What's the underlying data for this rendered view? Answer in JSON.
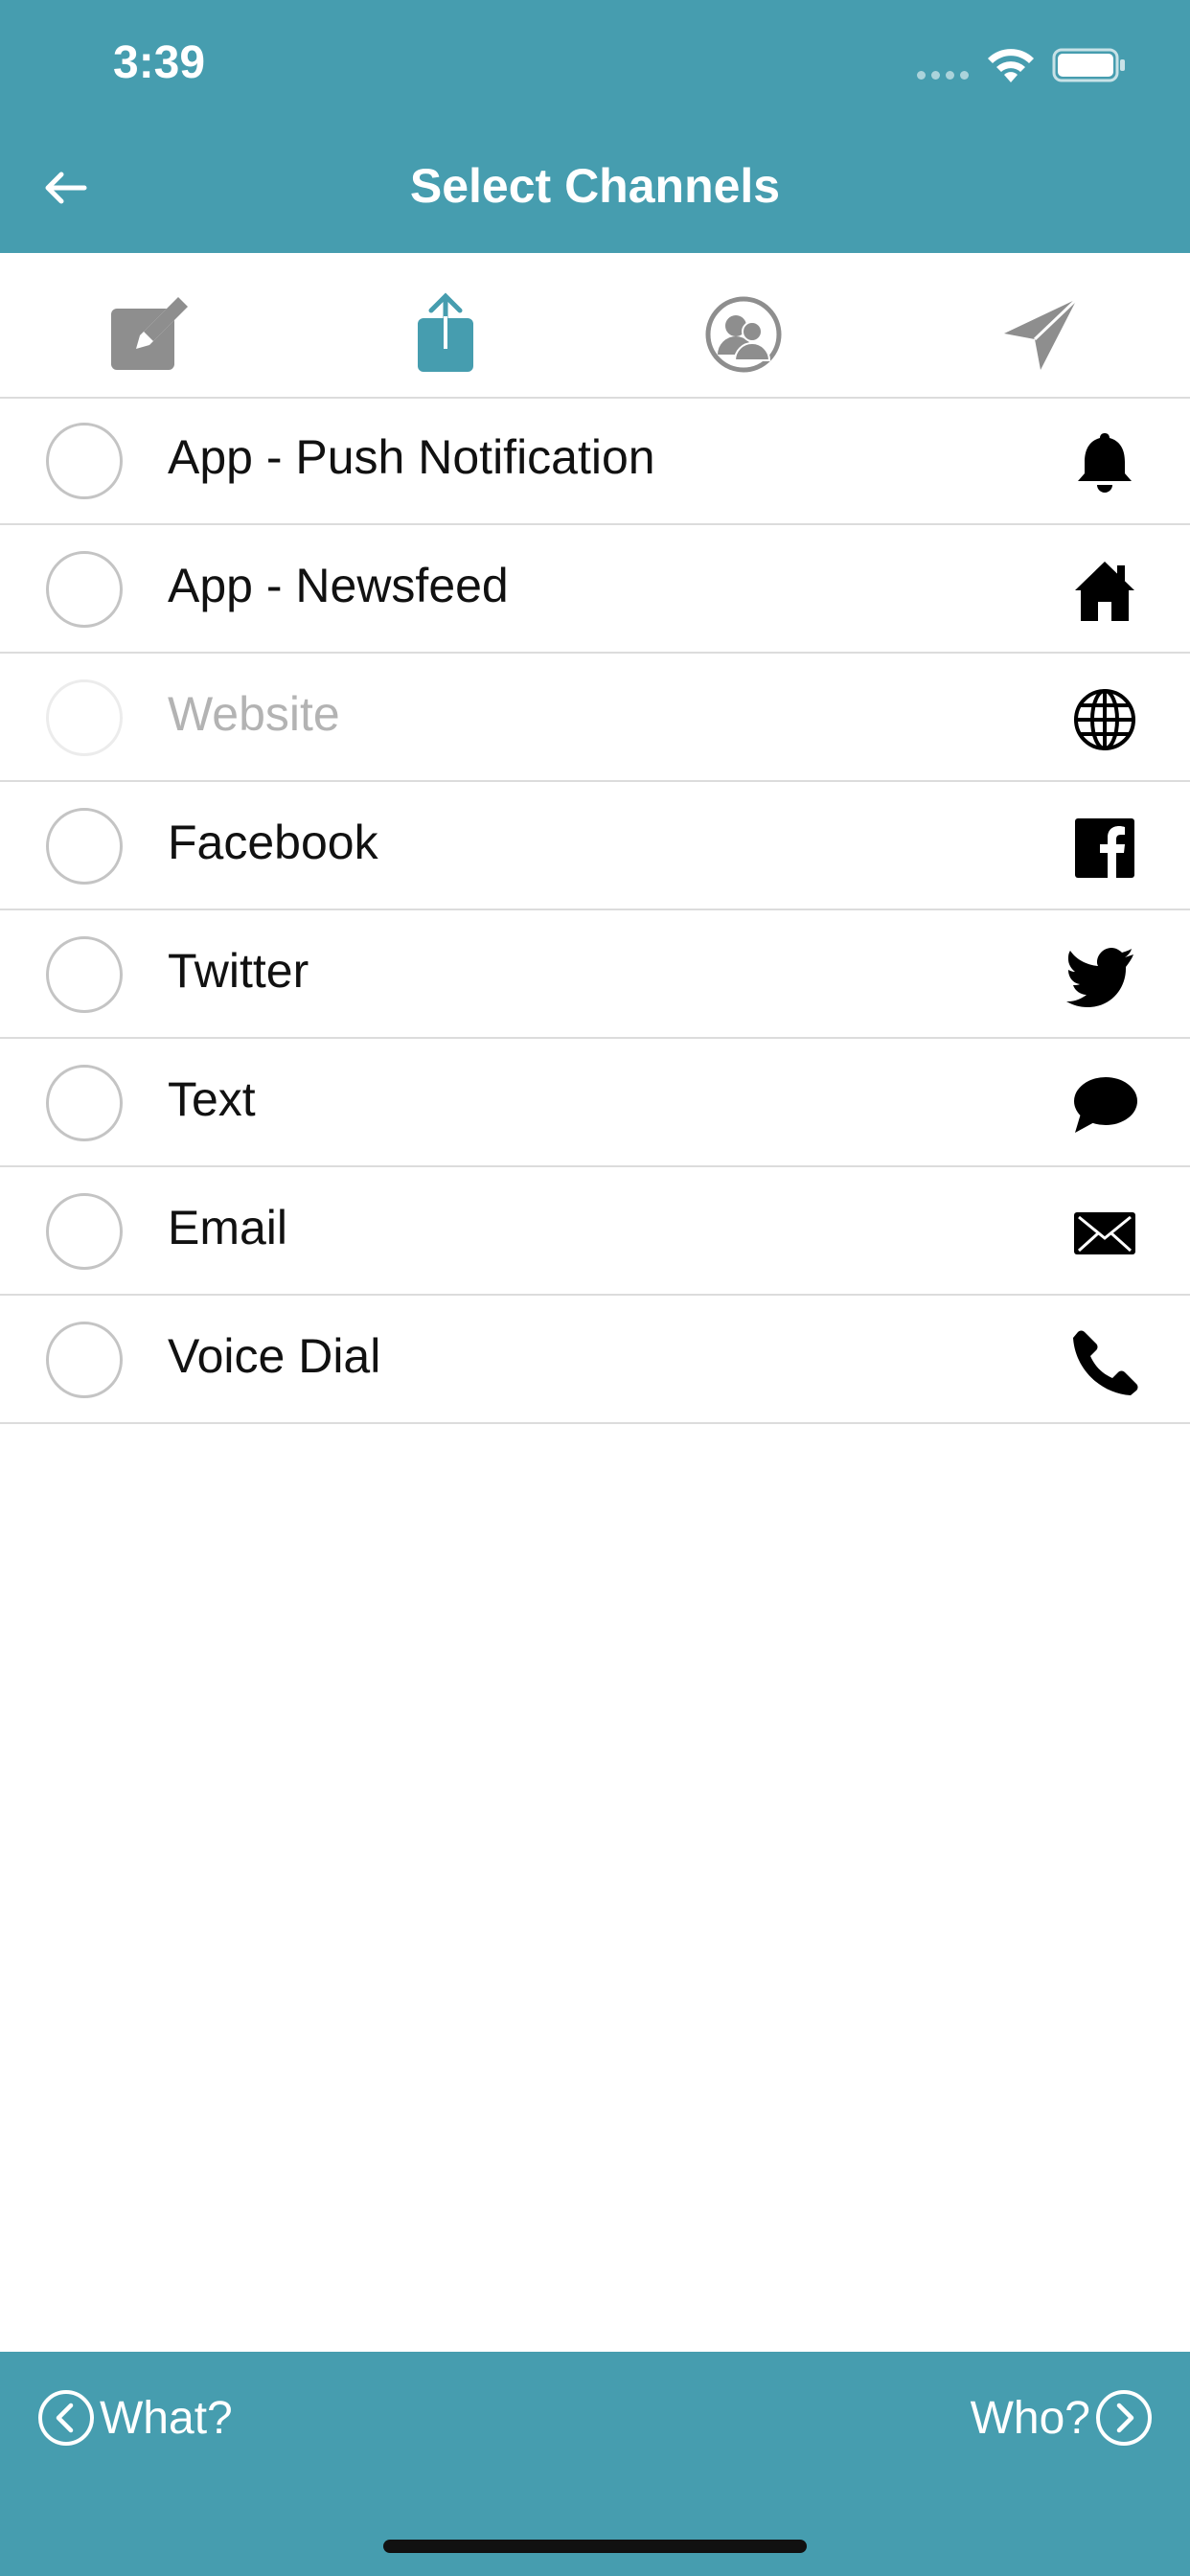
{
  "status_bar": {
    "time": "3:39"
  },
  "header": {
    "title": "Select Channels"
  },
  "steps": [
    {
      "name": "compose",
      "icon": "edit-icon",
      "active": false
    },
    {
      "name": "channels",
      "icon": "share-upload-icon",
      "active": true
    },
    {
      "name": "audience",
      "icon": "users-icon",
      "active": false
    },
    {
      "name": "send",
      "icon": "paper-plane-icon",
      "active": false
    }
  ],
  "channels": [
    {
      "label": "App - Push Notification",
      "icon": "bell-icon",
      "enabled": true
    },
    {
      "label": "App - Newsfeed",
      "icon": "home-icon",
      "enabled": true
    },
    {
      "label": "Website",
      "icon": "globe-icon",
      "enabled": false
    },
    {
      "label": "Facebook",
      "icon": "facebook-icon",
      "enabled": true
    },
    {
      "label": "Twitter",
      "icon": "twitter-icon",
      "enabled": true
    },
    {
      "label": "Text",
      "icon": "speech-bubble-icon",
      "enabled": true
    },
    {
      "label": "Email",
      "icon": "envelope-icon",
      "enabled": true
    },
    {
      "label": "Voice Dial",
      "icon": "phone-icon",
      "enabled": true
    }
  ],
  "footer": {
    "prev_label": "What?",
    "next_label": "Who?"
  },
  "colors": {
    "brand": "#469daf",
    "step_inactive": "#8e8e8e",
    "divider": "#dcdcdc"
  }
}
